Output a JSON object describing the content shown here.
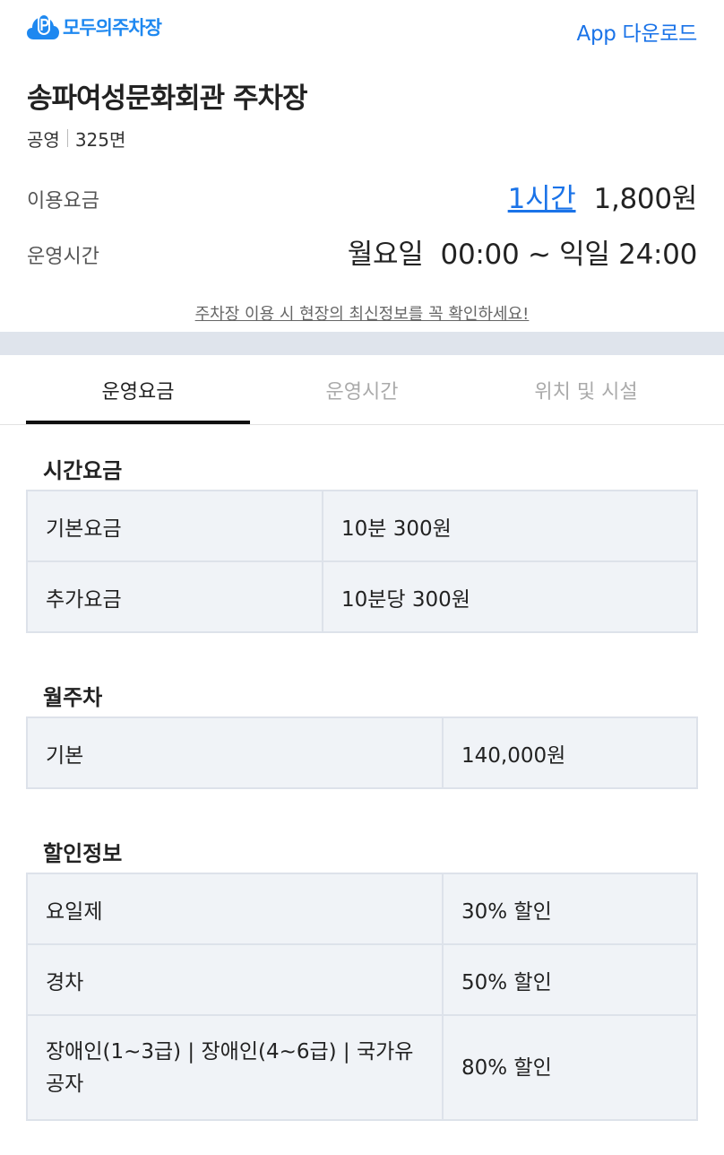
{
  "header": {
    "logo_text": "모두의주차장",
    "app_download": "App 다운로드"
  },
  "lot": {
    "name": "송파여성문화회관 주차장",
    "type": "공영",
    "capacity": "325면",
    "fee_label": "이용요금",
    "fee_time": "1시간",
    "fee_amount": "1,800원",
    "hours_label": "운영시간",
    "hours_value": "월요일  00:00 ~ 익일 24:00"
  },
  "notice": "주차장 이용 시 현장의 최신정보를 꼭 확인하세요!",
  "tabs": [
    {
      "label": "운영요금",
      "active": true
    },
    {
      "label": "운영시간",
      "active": false
    },
    {
      "label": "위치 및 시설",
      "active": false
    }
  ],
  "sections": {
    "hourly": {
      "title": "시간요금",
      "rows": [
        {
          "name": "기본요금",
          "value": "10분 300원"
        },
        {
          "name": "추가요금",
          "value": "10분당 300원"
        }
      ]
    },
    "monthly": {
      "title": "월주차",
      "rows": [
        {
          "name": "기본",
          "value": "140,000원"
        }
      ]
    },
    "discount": {
      "title": "할인정보",
      "rows": [
        {
          "name": "요일제",
          "value": "30% 할인"
        },
        {
          "name": "경차",
          "value": "50% 할인"
        },
        {
          "name": "장애인(1~3급) | 장애인(4~6급) | 국가유공자",
          "value": "80% 할인"
        }
      ]
    }
  },
  "colors": {
    "brand": "#1e88f0",
    "link": "#1a73e8",
    "table_bg": "#f0f3f7",
    "band": "#dfe4ec"
  },
  "icons": {
    "logo": "parking-cloud-icon"
  }
}
